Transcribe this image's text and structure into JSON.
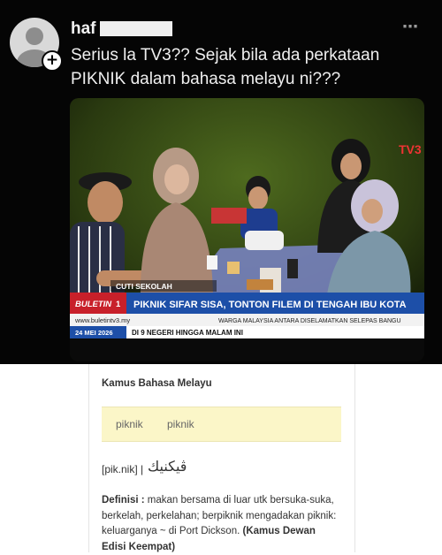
{
  "post": {
    "username": "haf",
    "more_icon": "⋯",
    "lines": [
      "Serius la TV3?? Sejak bila ada perkataan",
      "PIKNIK dalam bahasa melayu ni???"
    ]
  },
  "media": {
    "channel_logo": "TV3",
    "ticker": {
      "kicker": "CUTI SEKOLAH",
      "headline": "PIKNIK SIFAR SISA, TONTON FILEM DI TENGAH IBU KOTA",
      "brand": "BULETIN",
      "brand_num": "1",
      "url": "www.buletintv3.my",
      "date": "24 MEI 2026",
      "sub1": "DI 9 NEGERI HINGGA MALAM INI",
      "sub2": "WARGA MALAYSIA ANTARA DISELAMATKAN SELEPAS BANGU"
    }
  },
  "dictionary": {
    "title": "Kamus Bahasa Melayu",
    "entry_words": [
      "piknik",
      "piknik"
    ],
    "pronunciation": "[pik.nik] |",
    "jawi": "ڤيكنيك",
    "definition_label": "Definisi :",
    "definition_lines": [
      " makan bersama di luar utk bersuka-suka,",
      "berkelah, perkelahan; berpiknik mengadakan piknik:",
      "keluarganya ~ di Port Dickson. "
    ],
    "source_bold_1": "(Kamus Dewan",
    "source_bold_2": "Edisi Keempat)"
  },
  "colors": {
    "background_post": "#050505",
    "ticker_blue": "#1d4fa8",
    "ticker_red": "#c8202a",
    "dict_highlight": "#fbf6c8"
  }
}
